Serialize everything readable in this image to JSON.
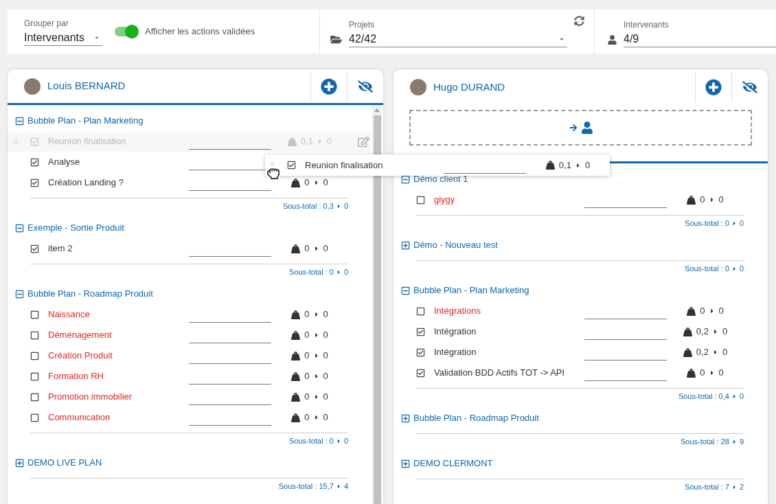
{
  "toolbar": {
    "group_by": {
      "label": "Grouper par",
      "value": "Intervenants"
    },
    "show_validated": {
      "label": "Afficher les actions validées",
      "on": true
    },
    "projects": {
      "label": "Projets",
      "value": "42/42"
    },
    "assignees": {
      "label": "Intervenants",
      "value": "4/9"
    }
  },
  "columns": [
    {
      "name": "Louis BERNARD",
      "drop_zone": false,
      "scrollbar": true,
      "groups": [
        {
          "title": "Bubble Plan - Plan Marketing",
          "expanded": true,
          "subtotal": "Sous-total : 0,3",
          "subtotal_to": "0",
          "tasks": [
            {
              "name": "Reunion finalisation",
              "checked": true,
              "late": false,
              "ghost": true,
              "from": "0,1",
              "to": "0"
            },
            {
              "name": "Analyse",
              "checked": true,
              "late": false,
              "ghost": false
            },
            {
              "name": "Création Landing ?",
              "checked": true,
              "late": false,
              "ghost": false,
              "from": "0",
              "to": "0"
            }
          ]
        },
        {
          "title": "Exemple - Sortie Produit",
          "expanded": true,
          "subtotal": "Sous-total : 0",
          "subtotal_to": "0",
          "tasks": [
            {
              "name": "item 2",
              "checked": true,
              "late": false,
              "ghost": false,
              "from": "0",
              "to": "0"
            }
          ]
        },
        {
          "title": "Bubble Plan - Roadmap Produit",
          "expanded": true,
          "subtotal": "Sous-total : 0",
          "subtotal_to": "0",
          "tasks": [
            {
              "name": "Naissance",
              "checked": false,
              "late": true,
              "ghost": false,
              "from": "0",
              "to": "0"
            },
            {
              "name": "Déménagement",
              "checked": false,
              "late": true,
              "ghost": false,
              "from": "0",
              "to": "0"
            },
            {
              "name": "Création Produit",
              "checked": false,
              "late": true,
              "ghost": false,
              "from": "0",
              "to": "0"
            },
            {
              "name": "Formation RH",
              "checked": false,
              "late": true,
              "ghost": false,
              "from": "0",
              "to": "0"
            },
            {
              "name": "Promotion immobilier",
              "checked": false,
              "late": true,
              "ghost": false,
              "from": "0",
              "to": "0"
            },
            {
              "name": "Communication",
              "checked": false,
              "late": true,
              "ghost": false,
              "from": "0",
              "to": "0"
            }
          ]
        },
        {
          "title": "DEMO LIVE PLAN",
          "expanded": false,
          "subtotal": "Sous-total : 15,7",
          "subtotal_to": "4"
        }
      ]
    },
    {
      "name": "Hugo DURAND",
      "drop_zone": true,
      "scrollbar": false,
      "groups": [
        {
          "title": "Démo client 1",
          "expanded": true,
          "subtotal": "Sous-total : 0",
          "subtotal_to": "0",
          "tasks": [
            {
              "name": "giygy",
              "checked": false,
              "late": true,
              "ghost": false,
              "from": "0",
              "to": "0"
            }
          ]
        },
        {
          "title": "Démo - Nouveau test",
          "expanded": false,
          "subtotal": "Sous-total : 0",
          "subtotal_to": "0"
        },
        {
          "title": "Bubble Plan - Plan Marketing",
          "expanded": true,
          "subtotal": "Sous-total : 0,4",
          "subtotal_to": "0",
          "tasks": [
            {
              "name": "Intégrations",
              "checked": false,
              "late": true,
              "ghost": false,
              "from": "0",
              "to": "0"
            },
            {
              "name": "Intégration",
              "checked": true,
              "late": false,
              "ghost": false,
              "from": "0,2",
              "to": "0"
            },
            {
              "name": "Intégration",
              "checked": true,
              "late": false,
              "ghost": false,
              "from": "0,2",
              "to": "0"
            },
            {
              "name": "Validation BDD Actifs TOT -> API",
              "checked": true,
              "late": false,
              "ghost": false,
              "from": "0",
              "to": "0"
            }
          ]
        },
        {
          "title": "Bubble Plan - Roadmap Produit",
          "expanded": false,
          "subtotal": "Sous-total : 28",
          "subtotal_to": "9"
        },
        {
          "title": "DEMO CLERMONT",
          "expanded": false,
          "subtotal": "Sous-total : 7",
          "subtotal_to": "2"
        }
      ]
    }
  ],
  "drag_preview": {
    "name": "Reunion finalisation",
    "checked": true,
    "from": "0,1",
    "to": "0"
  }
}
